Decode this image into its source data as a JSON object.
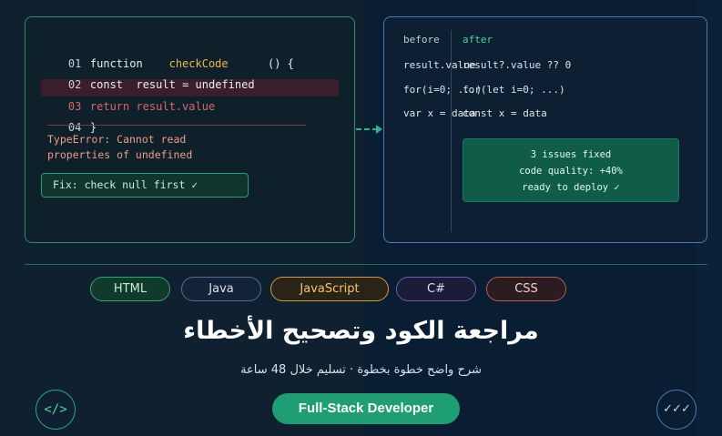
{
  "code_panel": {
    "lines": [
      {
        "num": "01",
        "a": "function",
        "b": "checkCode",
        "c": "() {"
      },
      {
        "num": "02",
        "a": "const",
        "b": "result",
        "c": "= undefined"
      },
      {
        "num": "03",
        "a": "return result.value"
      },
      {
        "num": "04",
        "a": "}"
      }
    ],
    "error_line1": "TypeError: Cannot read",
    "error_line2": "properties of undefined",
    "fix": "Fix: check null first ✓"
  },
  "compare_panel": {
    "before_label": "before",
    "after_label": "after",
    "rows": [
      {
        "before": "result.value",
        "after": "result?.value ?? 0"
      },
      {
        "before": "for(i=0; ...)",
        "after": "for(let i=0; ...)"
      },
      {
        "before": "var x = data",
        "after": "const x = data"
      }
    ],
    "result": {
      "line1": "3 issues fixed",
      "line2": "code quality: +40%",
      "line3": "ready to deploy ✓"
    }
  },
  "languages": [
    "HTML",
    "Java",
    "JavaScript",
    "C#",
    "CSS"
  ],
  "title": "مراجعة الكود وتصحيح الأخطاء",
  "subtitle": "شرح واضح خطوة بخطوة · تسليم خلال 48 ساعة",
  "cta": "Full-Stack Developer",
  "icons": {
    "left": "code-icon",
    "left_glyph": "</>",
    "right": "checks-icon",
    "right_glyph": "✓✓✓"
  },
  "colors": {
    "accent": "#1f9d73",
    "error": "#e0636a",
    "warning": "#f0b64a"
  }
}
